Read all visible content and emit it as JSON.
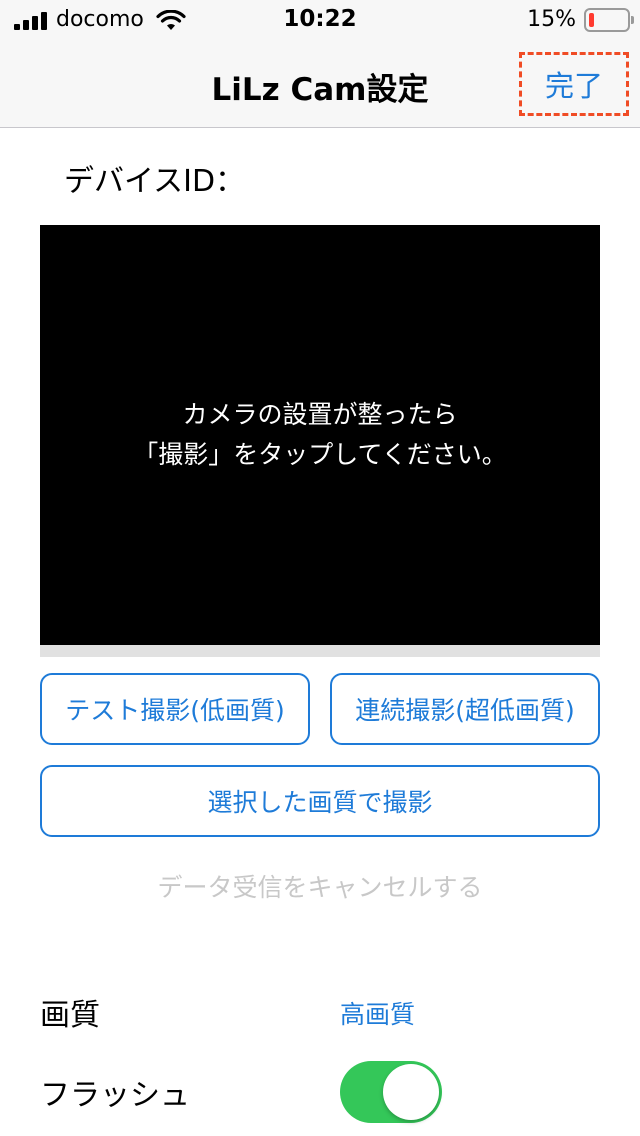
{
  "status_bar": {
    "carrier": "docomo",
    "time": "10:22",
    "battery_percent": "15%",
    "battery_level": 0.15,
    "battery_color": "#ff3b30"
  },
  "nav": {
    "title": "LiLz Cam設定",
    "done_label": "完了"
  },
  "device": {
    "label": "デバイスID："
  },
  "preview": {
    "message_line1": "カメラの設置が整ったら",
    "message_line2": "「撮影」をタップしてください。"
  },
  "buttons": {
    "test_shot": "テスト撮影(低画質)",
    "burst_shot": "連続撮影(超低画質)",
    "shoot_selected": "選択した画質で撮影"
  },
  "cancel_label": "データ受信をキャンセルする",
  "settings": {
    "quality_label": "画質",
    "quality_value": "高画質",
    "flash_label": "フラッシュ",
    "flash_on": true
  },
  "colors": {
    "accent": "#1e7bd8",
    "toggle_on": "#34c759",
    "highlight_dash": "#f04c25"
  },
  "icons": [
    "signal-icon",
    "wifi-icon",
    "battery-icon"
  ]
}
